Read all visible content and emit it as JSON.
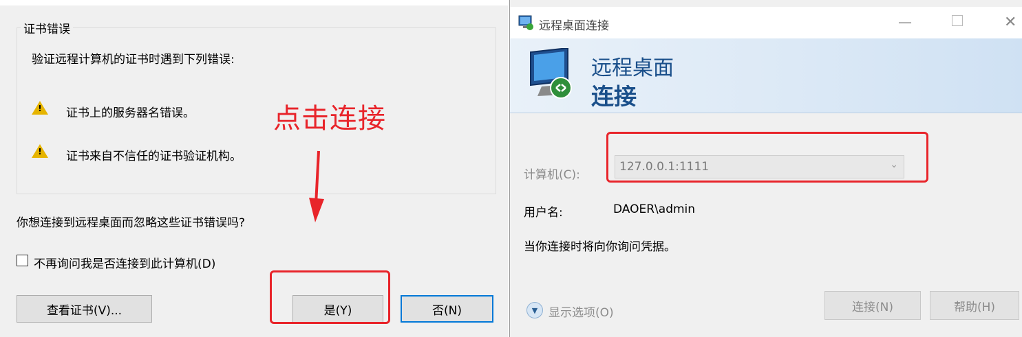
{
  "left_dialog": {
    "group_title": "证书错误",
    "intro": "验证远程计算机的证书时遇到下列错误:",
    "errors": [
      {
        "icon": "warning-icon",
        "text": "证书上的服务器名错误。"
      },
      {
        "icon": "warning-icon",
        "text": "证书来自不信任的证书验证机构。"
      }
    ],
    "question": "你想连接到远程桌面而忽略这些证书错误吗?",
    "checkbox_label": "不再询问我是否连接到此计算机(D)",
    "checkbox_checked": false,
    "view_cert_button": "查看证书(V)...",
    "yes_button": "是(Y)",
    "no_button": "否(N)"
  },
  "annotation": {
    "text": "点击连接",
    "color": "#e8242a"
  },
  "rdp_window": {
    "title": "远程桌面连接",
    "title_icon": "remote-desktop-icon",
    "controls": [
      "minimize-icon",
      "maximize-icon",
      "close-icon"
    ],
    "banner_line1": "远程桌面",
    "banner_line2": "连接",
    "banner_icon": "monitor-connection-icon",
    "computer_label": "计算机(C):",
    "computer_value": "127.0.0.1:1111",
    "username_label": "用户名:",
    "username_value": "DAOER\\admin",
    "credentials_note": "当你连接时将向你询问凭据。",
    "show_options": "显示选项(O)",
    "connect_button": "连接(N)",
    "help_button": "帮助(H)",
    "accent_color": "#1a4f8a"
  }
}
